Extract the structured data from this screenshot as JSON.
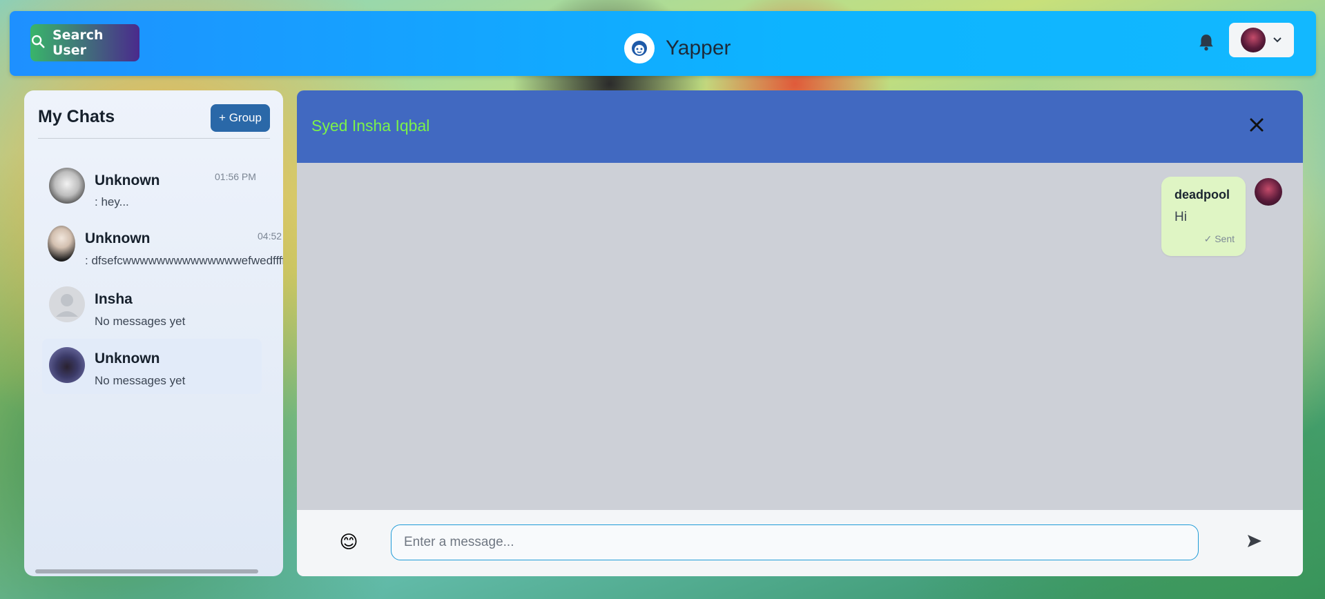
{
  "topbar": {
    "search_label": "Search User",
    "brand_name": "Yapper",
    "icons": {
      "search": "search-icon",
      "bell": "bell-icon",
      "chevron": "chevron-down-icon"
    }
  },
  "sidebar": {
    "title": "My Chats",
    "group_button": "+ Group",
    "chats": [
      {
        "name": "Unknown",
        "preview": ": hey...",
        "time": "01:56 PM",
        "active": false
      },
      {
        "name": "Unknown",
        "preview": ": dfsefcwwwwwwwwwwwwwwefwedffffff",
        "time": "04:52",
        "active": false
      },
      {
        "name": "Insha",
        "preview": "No messages yet",
        "time": "",
        "active": false
      },
      {
        "name": "Unknown",
        "preview": "No messages yet",
        "time": "",
        "active": true
      }
    ]
  },
  "chat": {
    "title": "Syed Insha Iqbal",
    "messages": [
      {
        "sender": "deadpool",
        "text": "Hi",
        "status": "✓ Sent"
      }
    ],
    "composer": {
      "placeholder": "Enter a message...",
      "emoji": "😊"
    }
  },
  "colors": {
    "topbar": "#0db4ff",
    "header": "#4169c1",
    "title_green": "#7cf24a",
    "bubble": "#dff5c4"
  }
}
